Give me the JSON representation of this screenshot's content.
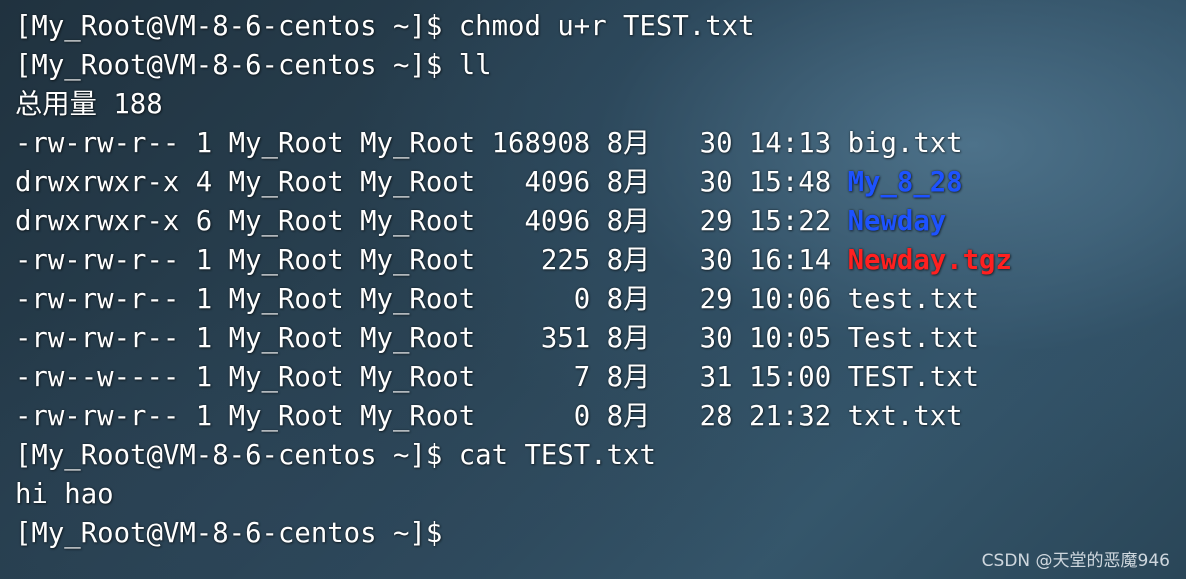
{
  "terminal": {
    "lines": [
      {
        "text": "[My_Root@VM-8-6-centos ~]$ chmod u+r TEST.txt"
      },
      {
        "text": "[My_Root@VM-8-6-centos ~]$ ll"
      },
      {
        "text": "总用量 188"
      },
      {
        "prefix": "-rw-rw-r-- 1 My_Root My_Root 168908 8月   30 14:13 ",
        "name": "big.txt",
        "type": "file"
      },
      {
        "prefix": "drwxrwxr-x 4 My_Root My_Root   4096 8月   30 15:48 ",
        "name": "My_8_28",
        "type": "directory"
      },
      {
        "prefix": "drwxrwxr-x 6 My_Root My_Root   4096 8月   29 15:22 ",
        "name": "Newday",
        "type": "directory"
      },
      {
        "prefix": "-rw-rw-r-- 1 My_Root My_Root    225 8月   30 16:14 ",
        "name": "Newday.tgz",
        "type": "archive"
      },
      {
        "prefix": "-rw-rw-r-- 1 My_Root My_Root      0 8月   29 10:06 ",
        "name": "test.txt",
        "type": "file"
      },
      {
        "prefix": "-rw-rw-r-- 1 My_Root My_Root    351 8月   30 10:05 ",
        "name": "Test.txt",
        "type": "file"
      },
      {
        "prefix": "-rw--w---- 1 My_Root My_Root      7 8月   31 15:00 ",
        "name": "TEST.txt",
        "type": "file"
      },
      {
        "prefix": "-rw-rw-r-- 1 My_Root My_Root      0 8月   28 21:32 ",
        "name": "txt.txt",
        "type": "file"
      },
      {
        "text": "[My_Root@VM-8-6-centos ~]$ cat TEST.txt"
      },
      {
        "text": "hi hao"
      },
      {
        "text": "[My_Root@VM-8-6-centos ~]$"
      }
    ]
  },
  "watermark": "CSDN @天堂的恶魔946",
  "colors": {
    "text": "#ffffff",
    "directory": "#1d52ff",
    "archive": "#ff2020"
  }
}
